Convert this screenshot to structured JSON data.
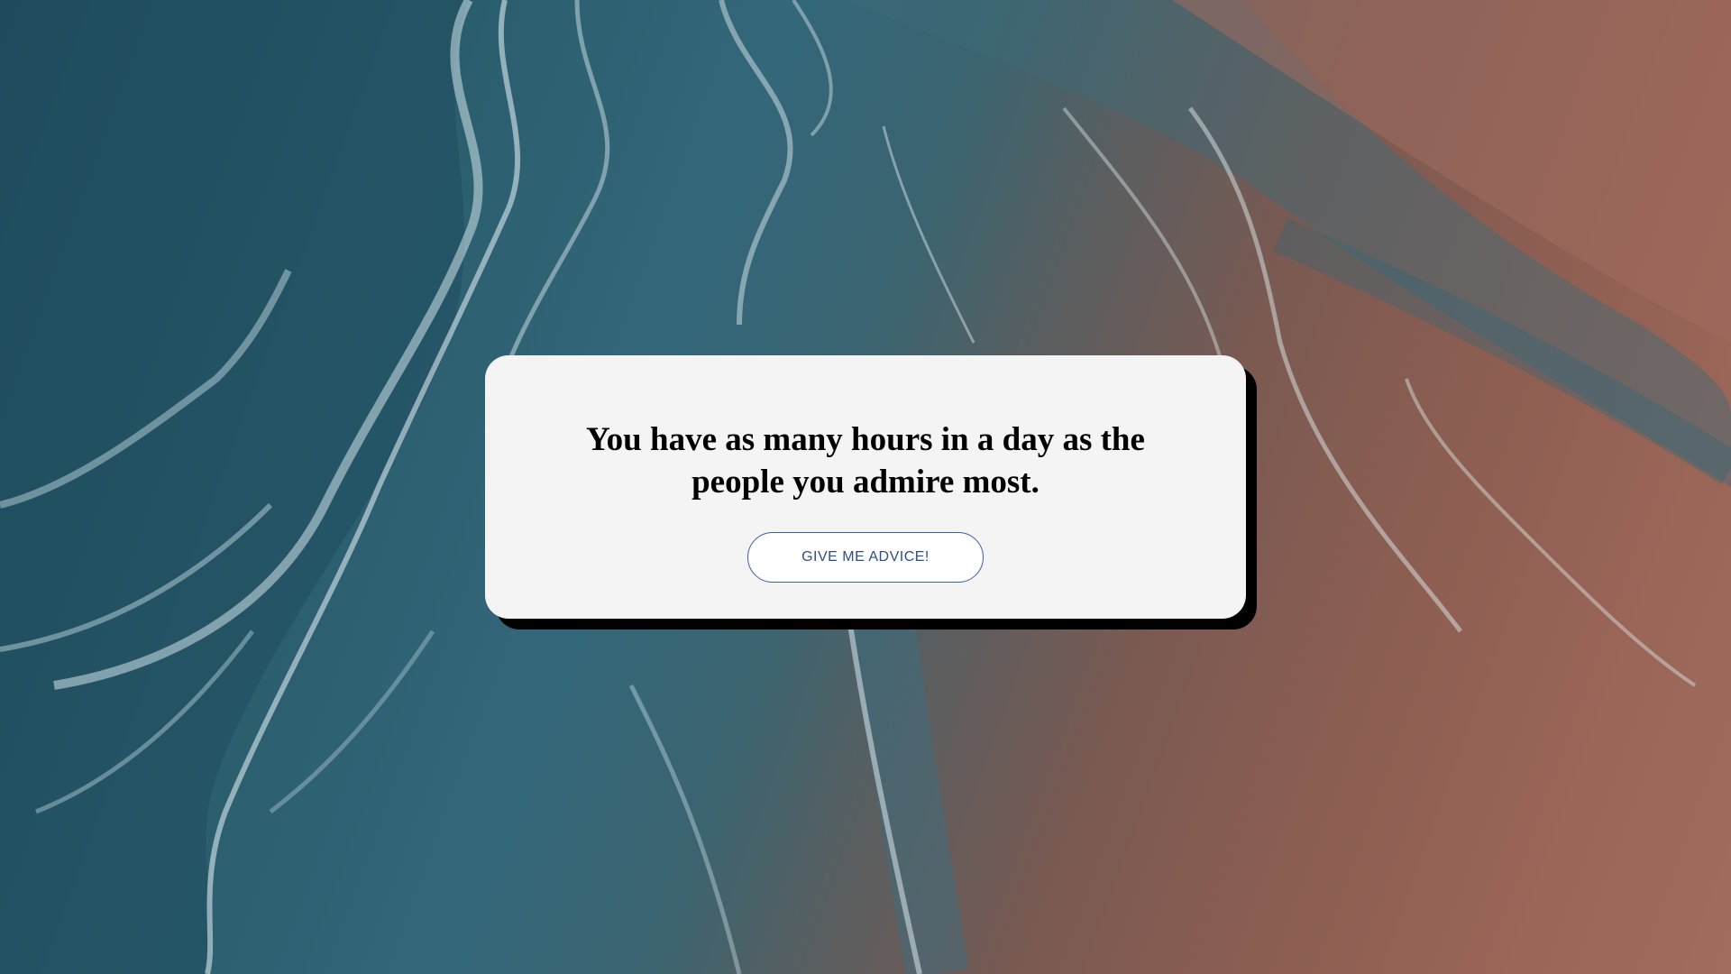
{
  "background": {
    "description_icon": "ocean-beach-aerial-image",
    "colors": {
      "sea_deep": "#1e4c5c",
      "sea_mid": "#33677a",
      "foam": "#cfe3ea",
      "sand": "#9a6658"
    }
  },
  "card": {
    "quote": "You have as many hours in a day as the people you admire most.",
    "button_label": "GIVE ME ADVICE!",
    "colors": {
      "card_bg": "#f4f4f4",
      "shadow": "#000000",
      "button_border": "#3f5f9c",
      "button_text": "#2e4d8a"
    }
  }
}
